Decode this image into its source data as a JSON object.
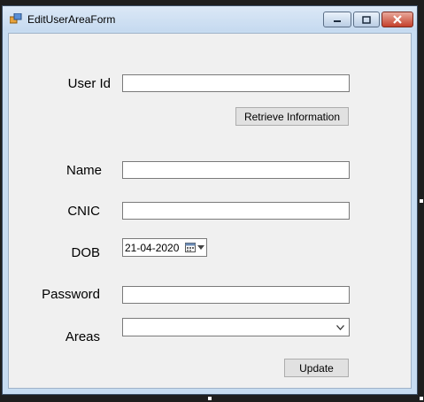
{
  "window": {
    "title": "EditUserAreaForm"
  },
  "form": {
    "user_id_label": "User Id",
    "user_id_value": "",
    "retrieve_button": "Retrieve Information",
    "name_label": "Name",
    "name_value": "",
    "cnic_label": "CNIC",
    "cnic_value": "",
    "dob_label": "DOB",
    "dob_value": "21-04-2020",
    "password_label": "Password",
    "password_value": "",
    "areas_label": "Areas",
    "areas_selected": "",
    "update_button": "Update"
  },
  "icons": {
    "app": "app-icon",
    "minimize": "minimize-icon",
    "maximize": "maximize-icon",
    "close": "close-icon",
    "calendar": "calendar-icon",
    "dropdown": "chevron-down-icon"
  },
  "colors": {
    "titlebar": "#c6daf0",
    "client": "#f0f0f0",
    "close_button": "#c4402b"
  }
}
